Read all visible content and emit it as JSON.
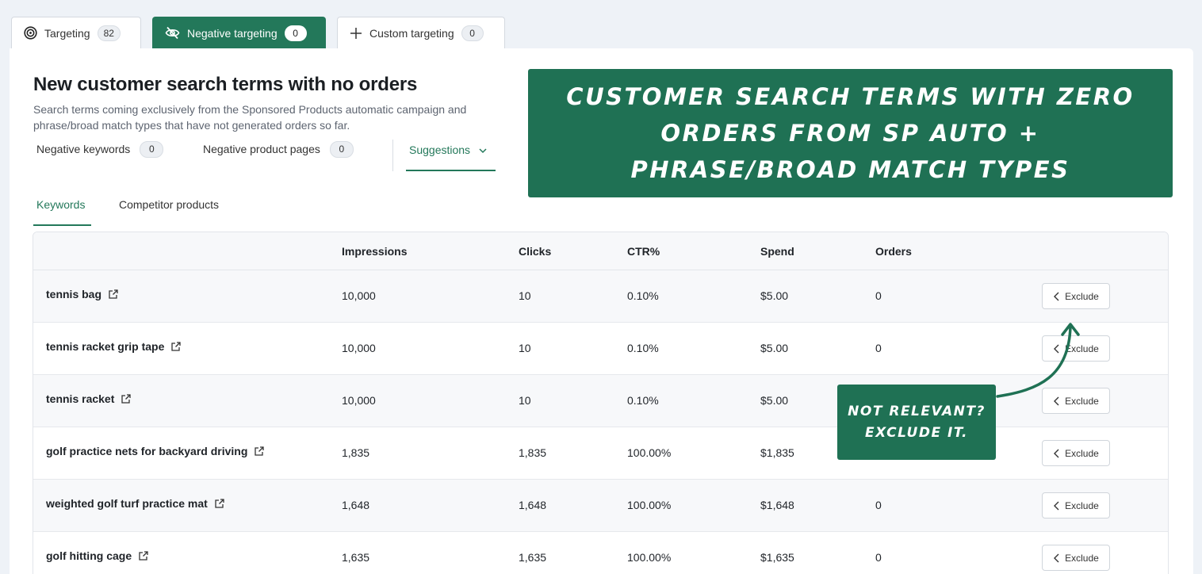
{
  "top_tabs": [
    {
      "label": "Targeting",
      "count": "82",
      "icon": "target-icon"
    },
    {
      "label": "Negative targeting",
      "count": "0",
      "icon": "eye-off-icon"
    },
    {
      "label": "Custom targeting",
      "count": "0",
      "icon": "plus-icon"
    }
  ],
  "section": {
    "title": "New customer search terms with no orders",
    "description": "Search terms coming exclusively from the Sponsored Products automatic campaign and phrase/broad match types that have not generated orders so far."
  },
  "subnav": {
    "negative_keywords_label": "Negative keywords",
    "negative_keywords_count": "0",
    "negative_product_pages_label": "Negative product pages",
    "negative_product_pages_count": "0",
    "suggestions_label": "Suggestions"
  },
  "kw_tabs": {
    "keywords": "Keywords",
    "competitor_products": "Competitor products"
  },
  "banner": {
    "text": "Customer search terms with zero orders from SP Auto + Phrase/Broad match types"
  },
  "callout": {
    "line1": "Not relevant?",
    "line2": "Exclude it."
  },
  "table": {
    "headers": {
      "impressions": "Impressions",
      "clicks": "Clicks",
      "ctr": "CTR%",
      "spend": "Spend",
      "orders": "Orders"
    },
    "exclude_label": "Exclude",
    "rows": [
      {
        "term": "tennis bag",
        "impressions": "10,000",
        "clicks": "10",
        "ctr": "0.10%",
        "spend": "$5.00",
        "orders": "0"
      },
      {
        "term": "tennis racket grip tape",
        "impressions": "10,000",
        "clicks": "10",
        "ctr": "0.10%",
        "spend": "$5.00",
        "orders": "0"
      },
      {
        "term": "tennis racket",
        "impressions": "10,000",
        "clicks": "10",
        "ctr": "0.10%",
        "spend": "$5.00",
        "orders": ""
      },
      {
        "term": "golf practice nets for backyard driving",
        "impressions": "1,835",
        "clicks": "1,835",
        "ctr": "100.00%",
        "spend": "$1,835",
        "orders": ""
      },
      {
        "term": "weighted golf turf practice mat",
        "impressions": "1,648",
        "clicks": "1,648",
        "ctr": "100.00%",
        "spend": "$1,648",
        "orders": "0"
      },
      {
        "term": "golf hitting cage",
        "impressions": "1,635",
        "clicks": "1,635",
        "ctr": "100.00%",
        "spend": "$1,635",
        "orders": "0"
      }
    ]
  },
  "colors": {
    "brand_green": "#23785a",
    "banner_green": "#1f7154"
  }
}
